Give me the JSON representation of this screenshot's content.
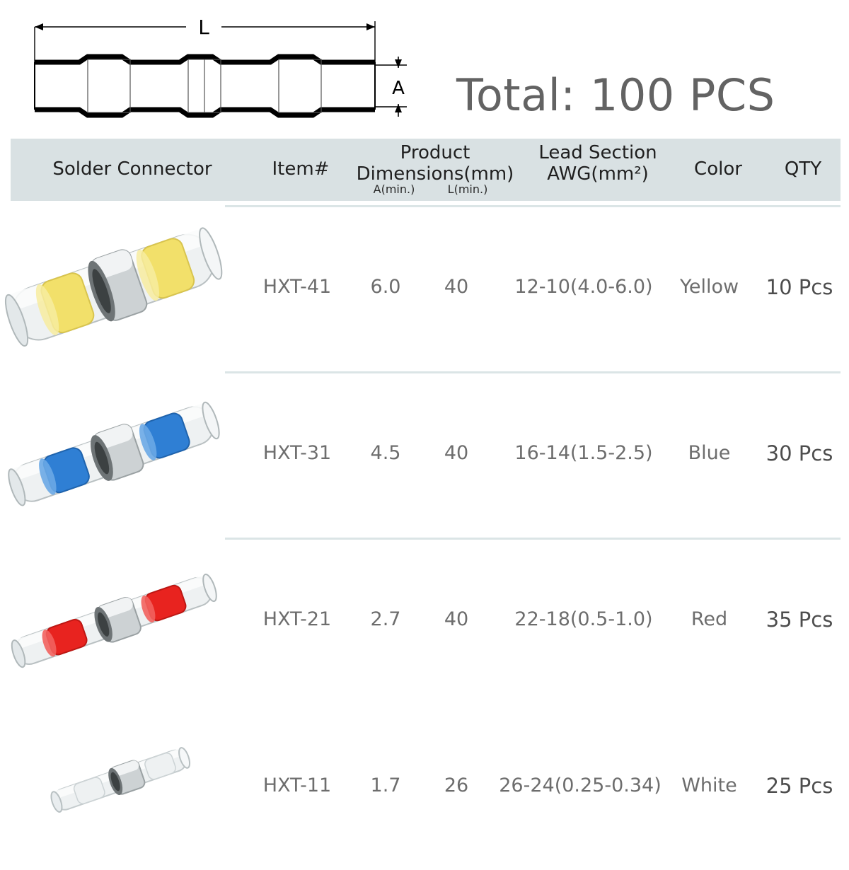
{
  "diagram": {
    "length_label": "L",
    "diameter_label": "A"
  },
  "total_badge": "Total: 100 PCS",
  "table": {
    "headers": {
      "connector": "Solder Connector",
      "item": "Item#",
      "dimensions": "Product\nDimensions(mm)",
      "dimensions_line1": "Product",
      "dimensions_line2": "Dimensions(mm)",
      "dim_a": "A(min.)",
      "dim_l": "L(min.)",
      "lead_line1": "Lead Section",
      "lead_line2": "AWG(mm²)",
      "color": "Color",
      "qty": "QTY"
    },
    "rows": [
      {
        "item": "HXT-41",
        "a_min": "6.0",
        "l_min": "40",
        "lead_section": "12-10(4.0-6.0)",
        "color": "Yellow",
        "qty": "10 Pcs",
        "swatch": "#f2e06a",
        "icon": "solder-connector-yellow"
      },
      {
        "item": "HXT-31",
        "a_min": "4.5",
        "l_min": "40",
        "lead_section": "16-14(1.5-2.5)",
        "color": "Blue",
        "qty": "30 Pcs",
        "swatch": "#2f7fd4",
        "icon": "solder-connector-blue"
      },
      {
        "item": "HXT-21",
        "a_min": "2.7",
        "l_min": "40",
        "lead_section": "22-18(0.5-1.0)",
        "color": "Red",
        "qty": "35 Pcs",
        "swatch": "#e8231f",
        "icon": "solder-connector-red"
      },
      {
        "item": "HXT-11",
        "a_min": "1.7",
        "l_min": "26",
        "lead_section": "26-24(0.25-0.34)",
        "color": "White",
        "qty": "25 Pcs",
        "swatch": "#e9ecee",
        "icon": "solder-connector-white"
      }
    ]
  },
  "colors": {
    "header_background": "#d9e1e3",
    "divider": "#dbe5e6",
    "text": "#6d6d6d",
    "heading_text": "#1f1f1f",
    "badge_text": "#636363"
  }
}
